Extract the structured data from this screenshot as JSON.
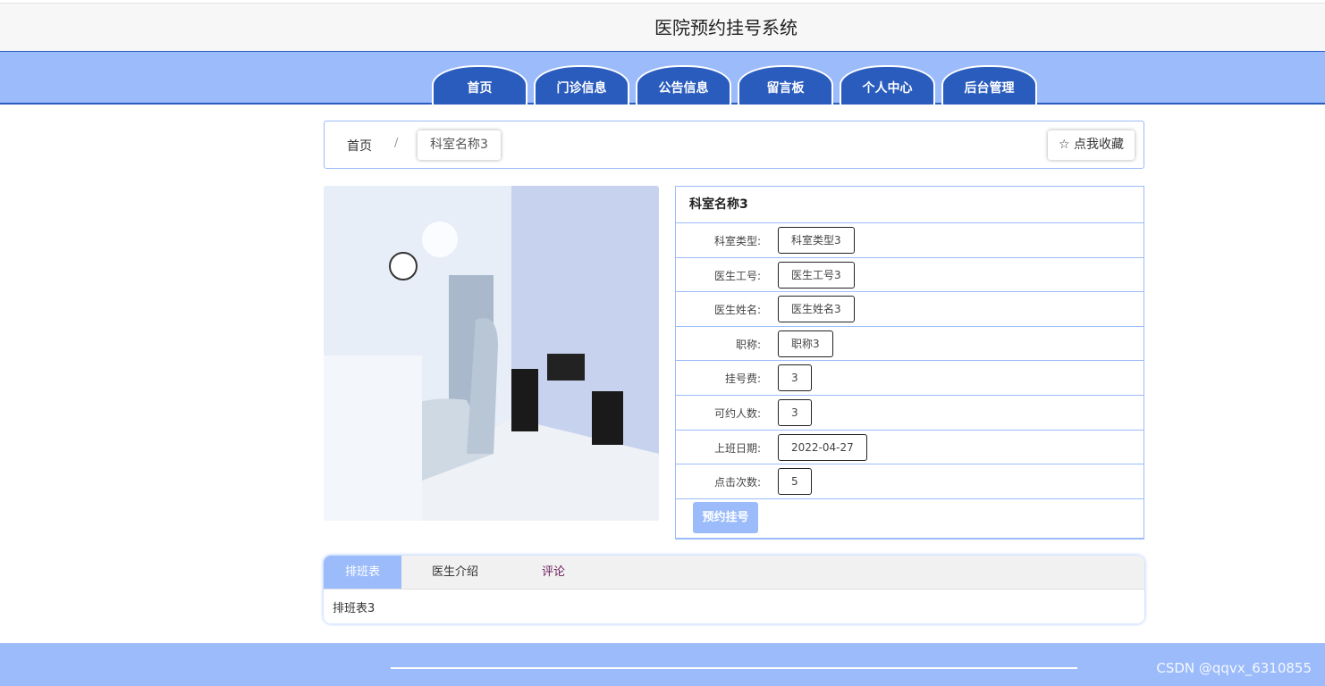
{
  "header": {
    "title": "医院预约挂号系统"
  },
  "nav": {
    "items": [
      "首页",
      "门诊信息",
      "公告信息",
      "留言板",
      "个人中心",
      "后台管理"
    ],
    "color": "#2a5cbd",
    "band_color": "#9bbbfb"
  },
  "breadcrumb": {
    "home": "首页",
    "separator": "/",
    "current": "科室名称3"
  },
  "favorite": {
    "icon": "star-outline-icon",
    "label": "☆ 点我收藏"
  },
  "detail": {
    "title": "科室名称3",
    "fields": [
      {
        "label": "科室类型:",
        "value": "科室类型3"
      },
      {
        "label": "医生工号:",
        "value": "医生工号3"
      },
      {
        "label": "医生姓名:",
        "value": "医生姓名3"
      },
      {
        "label": "职称:",
        "value": "职称3"
      },
      {
        "label": "挂号费:",
        "value": "3"
      },
      {
        "label": "可约人数:",
        "value": "3"
      },
      {
        "label": "上班日期:",
        "value": "2022-04-27"
      },
      {
        "label": "点击次数:",
        "value": "5"
      }
    ],
    "book_button": "预约挂号"
  },
  "tabs": {
    "items": [
      "排班表",
      "医生介绍",
      "评论"
    ],
    "active": 0,
    "content": "排班表3"
  },
  "watermark": "CSDN @qqvx_6310855"
}
